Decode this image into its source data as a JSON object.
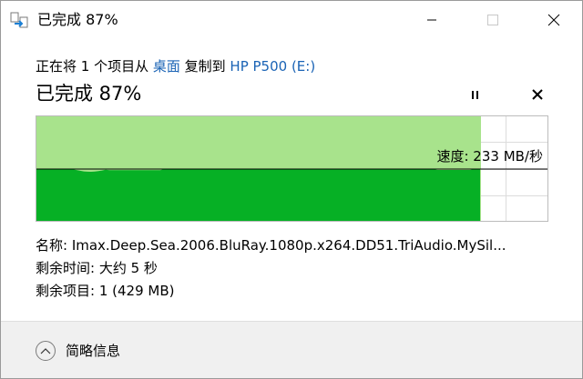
{
  "window": {
    "title": "已完成 87%",
    "accent_color": "#06b025",
    "chart_fill_color": "#a8e38c",
    "link_color": "#1a63b5"
  },
  "copy": {
    "prefix": "正在将 1 个项目从 ",
    "source": "桌面",
    "middle": " 复制到 ",
    "destination": "HP P500 (E:)"
  },
  "status": {
    "percent_complete": 87,
    "label": "已完成 87%"
  },
  "controls": {
    "pause_icon": "pause-icon",
    "cancel_icon": "close-icon",
    "minimize_icon": "minimize-icon",
    "maximize_icon": "maximize-icon",
    "close_icon": "close-icon"
  },
  "speed": {
    "label": "速度: 233 MB/秒"
  },
  "details": {
    "name_label": "名称: ",
    "name_value": "Imax.Deep.Sea.2006.BluRay.1080p.x264.DD51.TriAudio.MySil...",
    "time_label": "剩余时间: ",
    "time_value": "大约 5 秒",
    "items_label": "剩余项目: ",
    "items_value": "1 (429 MB)"
  },
  "footer": {
    "toggle_label": "简略信息",
    "toggle_icon": "chevron-up-icon"
  }
}
